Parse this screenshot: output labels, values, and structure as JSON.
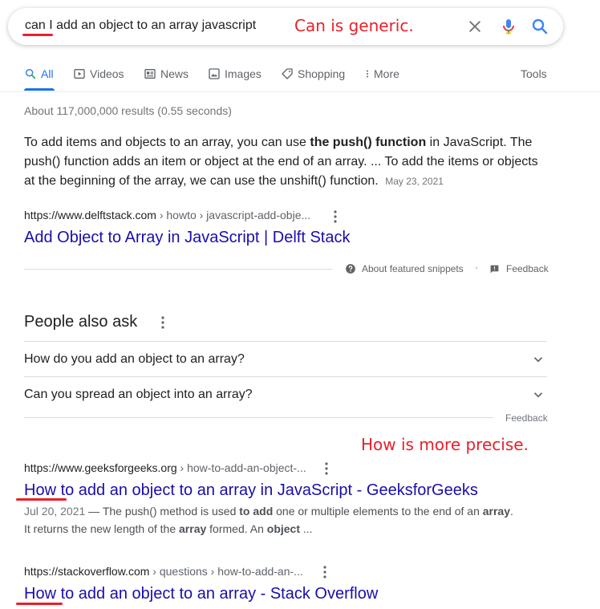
{
  "search": {
    "query": "can I add an object to an array javascript"
  },
  "annotations": {
    "top_note": "Can is generic.",
    "mid_note": "How is more precise."
  },
  "tabs": [
    {
      "label": "All",
      "icon": "search-icon",
      "active": true
    },
    {
      "label": "Videos",
      "icon": "video-icon"
    },
    {
      "label": "News",
      "icon": "news-icon"
    },
    {
      "label": "Images",
      "icon": "image-icon"
    },
    {
      "label": "Shopping",
      "icon": "tag-icon"
    },
    {
      "label": "More",
      "icon": "more-vert-icon"
    }
  ],
  "tools_label": "Tools",
  "result_stats": "About 117,000,000 results (0.55 seconds)",
  "featured_snippet": {
    "text_1": "To add items and objects to an array, you can use ",
    "text_bold": "the push() function",
    "text_2": " in JavaScript. The push() function adds an item or object at the end of an array. ... To add the items or objects at the beginning of the array, we can use the unshift() function.",
    "date": "May 23, 2021",
    "domain": "https://www.delftstack.com",
    "path": " › howto › javascript-add-obje...",
    "title": "Add Object to Array in JavaScript | Delft Stack",
    "about_label": "About featured snippets",
    "separator": "·",
    "feedback_label": "Feedback"
  },
  "people_also_ask": {
    "title": "People also ask",
    "questions": [
      "How do you add an object to an array?",
      "Can you spread an object into an array?"
    ],
    "feedback_label": "Feedback"
  },
  "results": [
    {
      "domain": "https://www.geeksforgeeks.org",
      "path": " › how-to-add-an-object-...",
      "title": "How to add an object to an array in JavaScript - GeeksforGeeks",
      "date": "Jul 20, 2021",
      "dash": " — ",
      "s1": "The push() method is used ",
      "s1b": "to add",
      "s2": " one or multiple elements to the end of an ",
      "s2b": "array",
      "s3": ".",
      "s4": "It returns the new length of the ",
      "s4b": "array",
      "s5": " formed. An ",
      "s5b": "object",
      "s6": " ..."
    },
    {
      "domain": "https://stackoverflow.com",
      "path": " › questions › how-to-add-an-...",
      "title": "How to add an object to an array - Stack Overflow"
    }
  ],
  "colors": {
    "link": "#1a0dab",
    "accent": "#1a73e8",
    "annotation": "#e8202a"
  }
}
